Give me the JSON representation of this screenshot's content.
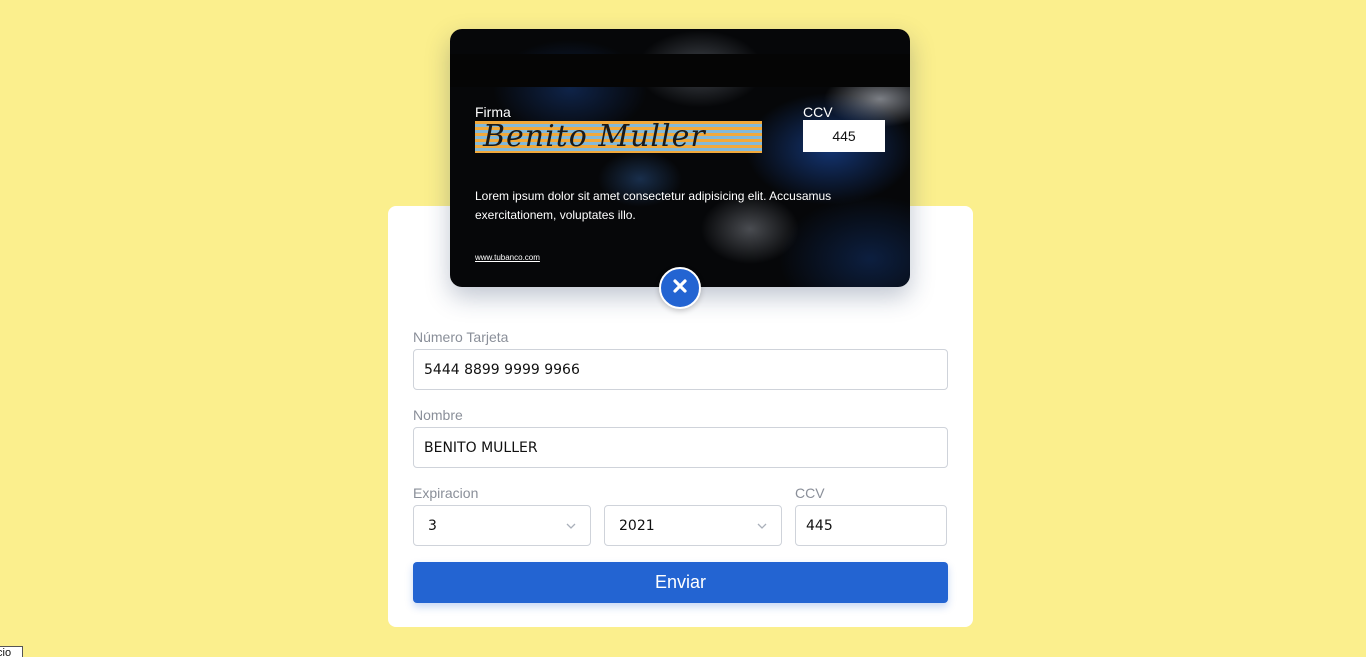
{
  "card": {
    "signature_label": "Firma",
    "signature": "Benito Muller",
    "ccv_label": "CCV",
    "ccv": "445",
    "description": "Lorem ipsum dolor sit amet consectetur adipisicing elit. Accusamus exercitationem, voluptates illo.",
    "bank_url": "www.tubanco.com"
  },
  "toggle": {
    "icon": "close-icon"
  },
  "form": {
    "number_label": "Número Tarjeta",
    "number_value": "5444 8899 9999 9966",
    "name_label": "Nombre",
    "name_value": "BENITO MULLER",
    "expiration_label": "Expiracion",
    "month_value": "3",
    "year_value": "2021",
    "ccv_label": "CCV",
    "ccv_value": "445",
    "submit_label": "Enviar"
  },
  "corner_tab": {
    "label": "cio"
  },
  "colors": {
    "background": "#fbef8d",
    "accent": "#2364d2",
    "panel": "#ffffff"
  }
}
